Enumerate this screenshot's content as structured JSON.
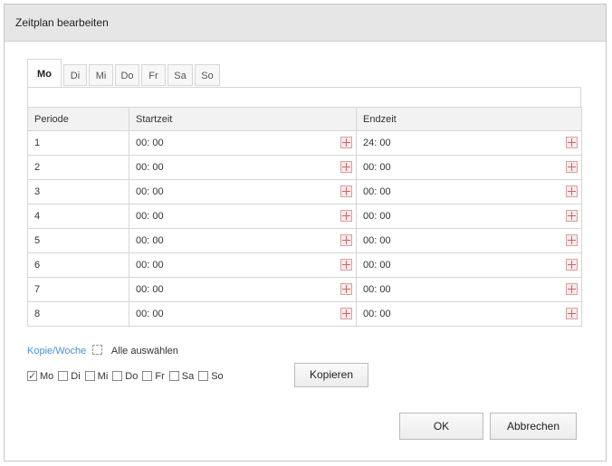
{
  "dialog": {
    "title": "Zeitplan bearbeiten"
  },
  "tabs": [
    {
      "label": "Mo",
      "active": true
    },
    {
      "label": "Di",
      "active": false
    },
    {
      "label": "Mi",
      "active": false
    },
    {
      "label": "Do",
      "active": false
    },
    {
      "label": "Fr",
      "active": false
    },
    {
      "label": "Sa",
      "active": false
    },
    {
      "label": "So",
      "active": false
    }
  ],
  "table": {
    "headers": {
      "period": "Periode",
      "start": "Startzeit",
      "end": "Endzeit"
    },
    "rows": [
      {
        "period": "1",
        "start": "00: 00",
        "end": "24: 00"
      },
      {
        "period": "2",
        "start": "00: 00",
        "end": "00: 00"
      },
      {
        "period": "3",
        "start": "00: 00",
        "end": "00: 00"
      },
      {
        "period": "4",
        "start": "00: 00",
        "end": "00: 00"
      },
      {
        "period": "5",
        "start": "00: 00",
        "end": "00: 00"
      },
      {
        "period": "6",
        "start": "00: 00",
        "end": "00: 00"
      },
      {
        "period": "7",
        "start": "00: 00",
        "end": "00: 00"
      },
      {
        "period": "8",
        "start": "00: 00",
        "end": "00: 00"
      }
    ]
  },
  "copy": {
    "link_label": "Kopie/Woche",
    "select_all_label": "Alle auswählen",
    "select_all_checked": false,
    "days": [
      {
        "label": "Mo",
        "checked": true
      },
      {
        "label": "Di",
        "checked": false
      },
      {
        "label": "Mi",
        "checked": false
      },
      {
        "label": "Do",
        "checked": false
      },
      {
        "label": "Fr",
        "checked": false
      },
      {
        "label": "Sa",
        "checked": false
      },
      {
        "label": "So",
        "checked": false
      }
    ],
    "copy_button_label": "Kopieren"
  },
  "footer": {
    "ok_label": "OK",
    "cancel_label": "Abbrechen"
  },
  "colors": {
    "link": "#4a90d9",
    "titlebar_bg": "#e6e6e6",
    "calendar_icon": "#c66666"
  },
  "icons": {
    "time_picker": "calendar-icon",
    "checkbox_checked": "checkmark"
  }
}
